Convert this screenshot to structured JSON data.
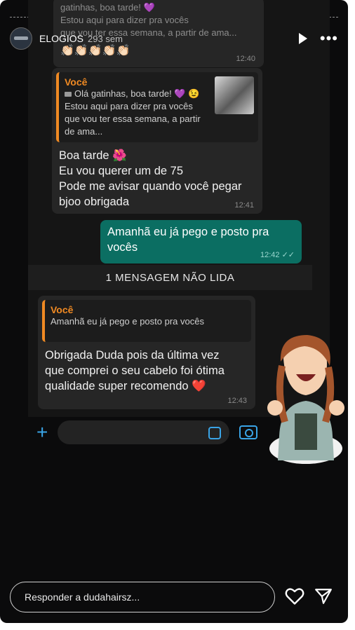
{
  "header": {
    "username": "ELOGIOS",
    "time_ago": "293 sem"
  },
  "chat": {
    "top_partial": {
      "line1": "gatinhas, boa tarde! 💜",
      "line2": "Estou aqui para dizer pra vocês",
      "line3": "que vou ter essa semana, a partir de ama...",
      "emoji_row": "👏🏻👏🏻👏🏻👏🏻👏🏻",
      "time": "12:40"
    },
    "msg1": {
      "quote_name": "Você",
      "quote_line1": "Olá gatinhas, boa tarde! 💜 😉",
      "quote_line2": "Estou aqui para dizer pra vocês",
      "quote_line3": "que vou ter essa semana, a partir de ama...",
      "line1": "Boa tarde 🌺",
      "line2": "Eu vou querer um de 75",
      "line3": "Pode me avisar quando você pegar",
      "line4": "bjoo obrigada",
      "time": "12:41"
    },
    "msg2": {
      "line1": "Amanhã eu já pego e posto pra",
      "line2": "vocês",
      "time": "12:42"
    },
    "unread_label": "1 MENSAGEM NÃO LIDA",
    "msg3": {
      "quote_name": "Você",
      "quote_text": "Amanhã eu já pego e posto pra vocês",
      "line1": "Obrigada Duda pois da última vez",
      "line2": "que comprei o seu cabelo foi ótima",
      "line3": "qualidade super recomendo ❤️",
      "time": "12:43"
    }
  },
  "footer": {
    "reply_placeholder": "Responder a dudahairsz..."
  }
}
